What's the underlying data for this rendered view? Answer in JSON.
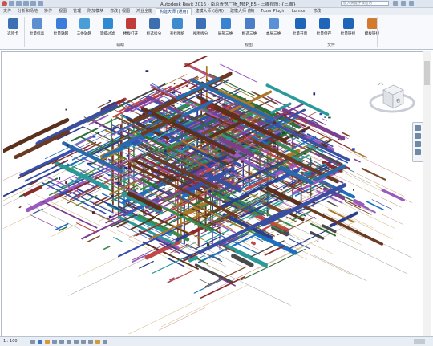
{
  "window": {
    "title": "Autodesk Revit 2016 -   南京青悦广场_MEP_B5 - 三维视图: {三维}",
    "search_placeholder": "键入关键字或短语"
  },
  "tabs": [
    "文件",
    "分析和场地",
    "协作",
    "视图",
    "管理",
    "附加模块",
    "修改 | 视图",
    "鸿业全能",
    "构建大师 (通用)",
    "建模大师 (通用)",
    "建模大师 (族)",
    "Fuzor Plugin",
    "Lumion",
    "修改"
  ],
  "active_tab_index": 8,
  "ribbon": {
    "buttons": [
      {
        "label": "选项卡",
        "icon": "tab-options-icon",
        "color": "#3c6fb4"
      },
      {
        "label": "批量标高",
        "icon": "level-icon",
        "color": "#5b8fd1"
      },
      {
        "label": "批量轴网",
        "icon": "grid-icon",
        "color": "#3b7dd8"
      },
      {
        "label": "三维轴网",
        "icon": "3d-grid-icon",
        "color": "#4a9ed8"
      },
      {
        "label": "等级过滤",
        "icon": "filter-icon",
        "color": "#2f8ad2"
      },
      {
        "label": "楼板打开",
        "icon": "floor-open-icon",
        "color": "#c23b3b"
      },
      {
        "label": "框选拆分",
        "icon": "split-icon",
        "color": "#3d6fb0"
      },
      {
        "label": "查找图纸",
        "icon": "find-sheet-icon",
        "color": "#3f8bd0"
      },
      {
        "label": "视图拆分",
        "icon": "view-split-icon",
        "color": "#3c6fb4"
      },
      {
        "label": "局部三维",
        "icon": "local-3d-icon",
        "color": "#3a84cf"
      },
      {
        "label": "框选三维",
        "icon": "box-3d-icon",
        "color": "#4a7fc7"
      },
      {
        "label": "本层三维",
        "icon": "level-3d-icon",
        "color": "#5a91d4"
      },
      {
        "label": "批量开窗",
        "icon": "batch-window-icon",
        "color": "#1f66b8"
      },
      {
        "label": "批量保存",
        "icon": "batch-save-icon",
        "color": "#1f66b8"
      },
      {
        "label": "批量链接",
        "icon": "batch-link-icon",
        "color": "#1f66b8"
      },
      {
        "label": "模板链接",
        "icon": "template-link-icon",
        "color": "#d47a2c"
      }
    ],
    "groups": [
      "辅助",
      "视图",
      "文件"
    ]
  },
  "status": {
    "scale": "1 : 100"
  }
}
